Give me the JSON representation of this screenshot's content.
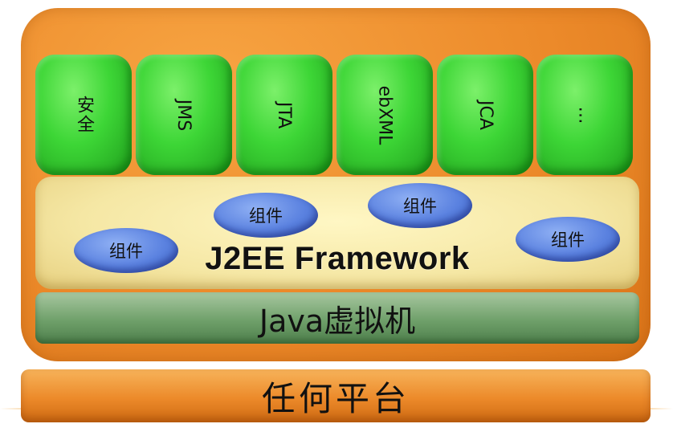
{
  "services": [
    {
      "label": "安全",
      "name": "service-security"
    },
    {
      "label": "JMS",
      "name": "service-jms"
    },
    {
      "label": "JTA",
      "name": "service-jta"
    },
    {
      "label": "ebXML",
      "name": "service-ebxml"
    },
    {
      "label": "JCA",
      "name": "service-jca"
    },
    {
      "label": "…",
      "name": "service-more"
    }
  ],
  "framework": {
    "title": "J2EE Framework",
    "components": [
      "组件",
      "组件",
      "组件",
      "组件"
    ]
  },
  "jvm": {
    "label": "Java虚拟机"
  },
  "platform": {
    "label": "任何平台"
  },
  "colors": {
    "container": "#ec8a2a",
    "service": "#3dd636",
    "framework": "#f5e7a4",
    "component": "#5b82e0",
    "jvm": "#6fa06a",
    "platform": "#ec8a2a"
  }
}
